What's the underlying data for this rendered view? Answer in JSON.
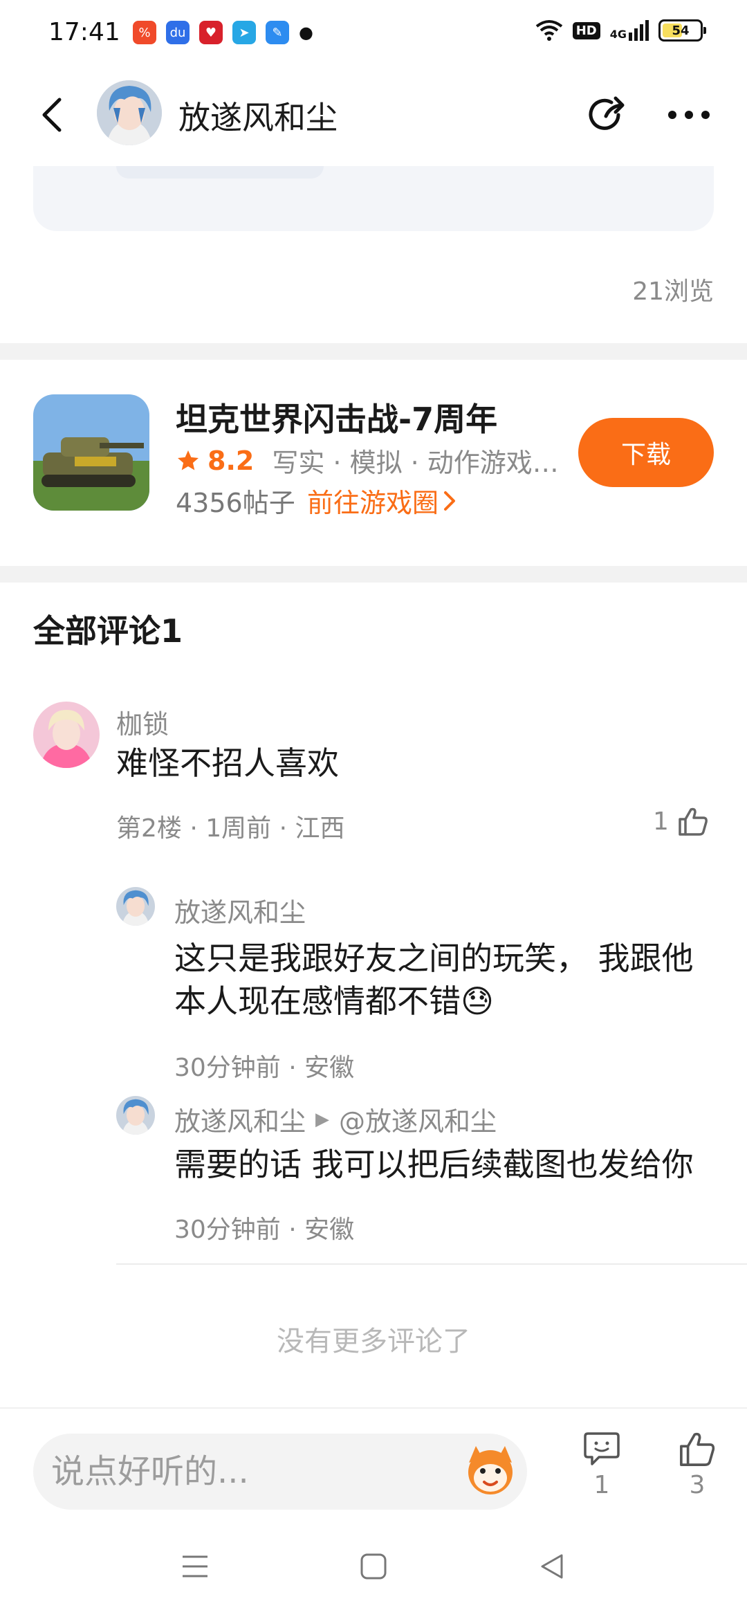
{
  "status_bar": {
    "time": "17:41",
    "network": "4G",
    "hd": "HD",
    "battery": "54",
    "battery_level": 0.54
  },
  "header": {
    "title": "放遂风和尘"
  },
  "post": {
    "views": "21浏览"
  },
  "game": {
    "title": "坦克世界闪击战-7周年",
    "rating": "8.2",
    "tags": "写实 · 模拟 · 动作游戏…",
    "posts": "4356帖子",
    "link": "前往游戏圈",
    "download": "下载",
    "accent": "#fa6d16"
  },
  "comments": {
    "heading": "全部评论1",
    "items": [
      {
        "name": "枷锁",
        "text": "难怪不招人喜欢",
        "meta": "第2楼 · 1周前 · 江西",
        "likes": "1"
      }
    ],
    "replies": [
      {
        "name": "放遂风和尘",
        "text_line1": "这只是我跟好友之间的玩笑， 我跟他",
        "text_line2": "本人现在感情都不错😓",
        "meta": "30分钟前 · 安徽"
      },
      {
        "name": "放遂风和尘",
        "reply_to": "@放遂风和尘",
        "text": "需要的话 我可以把后续截图也发给你",
        "meta": "30分钟前 · 安徽"
      }
    ],
    "no_more": "没有更多评论了"
  },
  "input_bar": {
    "placeholder": "说点好听的...",
    "comment_count": "1",
    "like_count": "3"
  }
}
